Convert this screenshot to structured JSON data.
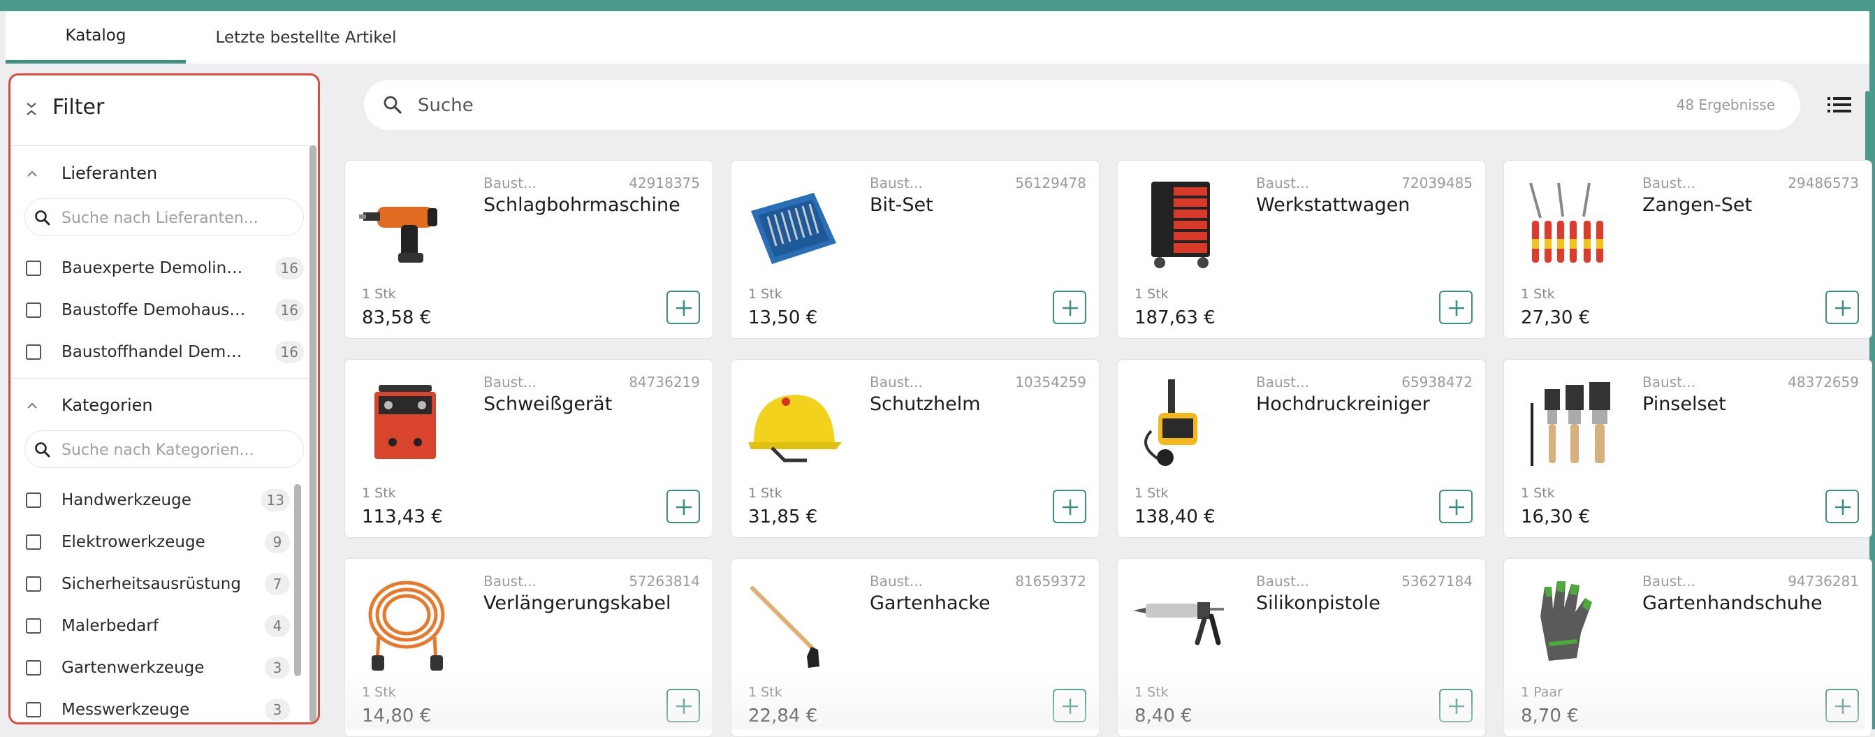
{
  "tabs": [
    {
      "label": "Katalog",
      "active": true
    },
    {
      "label": "Letzte bestellte Artikel",
      "active": false
    }
  ],
  "sidebar": {
    "title": "Filter",
    "sections": [
      {
        "title": "Lieferanten",
        "search_placeholder": "Suche nach Lieferanten...",
        "items": [
          {
            "label": "Bauexperte Demolinger",
            "count": "16"
          },
          {
            "label": "Baustoffe Demohausen",
            "count": "16"
          },
          {
            "label": "Baustoffhandel Demolinger",
            "count": "16"
          }
        ]
      },
      {
        "title": "Kategorien",
        "search_placeholder": "Suche nach Kategorien...",
        "items": [
          {
            "label": "Handwerkzeuge",
            "count": "13"
          },
          {
            "label": "Elektrowerkzeuge",
            "count": "9"
          },
          {
            "label": "Sicherheitsausrüstung",
            "count": "7"
          },
          {
            "label": "Malerbedarf",
            "count": "4"
          },
          {
            "label": "Gartenwerkzeuge",
            "count": "3"
          },
          {
            "label": "Messwerkzeuge",
            "count": "3"
          }
        ]
      }
    ]
  },
  "search": {
    "placeholder": "Suche",
    "results": "48 Ergebnisse"
  },
  "products": [
    {
      "supplier": "Baust...",
      "artno": "42918375",
      "name": "Schlagbohrmaschine",
      "unit": "1 Stk",
      "price": "83,58 €",
      "icon": "drill-icon"
    },
    {
      "supplier": "Baust...",
      "artno": "56129478",
      "name": "Bit-Set",
      "unit": "1 Stk",
      "price": "13,50 €",
      "icon": "bit-set-icon"
    },
    {
      "supplier": "Baust...",
      "artno": "72039485",
      "name": "Werkstattwagen",
      "unit": "1 Stk",
      "price": "187,63 €",
      "icon": "tool-cart-icon"
    },
    {
      "supplier": "Baust...",
      "artno": "29486573",
      "name": "Zangen-Set",
      "unit": "1 Stk",
      "price": "27,30 €",
      "icon": "pliers-icon"
    },
    {
      "supplier": "Baust...",
      "artno": "84736219",
      "name": "Schweißgerät",
      "unit": "1 Stk",
      "price": "113,43 €",
      "icon": "welder-icon"
    },
    {
      "supplier": "Baust...",
      "artno": "10354259",
      "name": "Schutzhelm",
      "unit": "1 Stk",
      "price": "31,85 €",
      "icon": "helmet-icon"
    },
    {
      "supplier": "Baust...",
      "artno": "65938472",
      "name": "Hochdruckreiniger",
      "unit": "1 Stk",
      "price": "138,40 €",
      "icon": "pressure-washer-icon"
    },
    {
      "supplier": "Baust...",
      "artno": "48372659",
      "name": "Pinselset",
      "unit": "1 Stk",
      "price": "16,30 €",
      "icon": "brushes-icon"
    },
    {
      "supplier": "Baust...",
      "artno": "57263814",
      "name": "Verlängerungskabel",
      "unit": "1 Stk",
      "price": "14,80 €",
      "icon": "cable-reel-icon"
    },
    {
      "supplier": "Baust...",
      "artno": "81659372",
      "name": "Gartenhacke",
      "unit": "1 Stk",
      "price": "22,84 €",
      "icon": "hoe-icon"
    },
    {
      "supplier": "Baust...",
      "artno": "53627184",
      "name": "Silikonpistole",
      "unit": "1 Stk",
      "price": "8,40 €",
      "icon": "caulk-gun-icon"
    },
    {
      "supplier": "Baust...",
      "artno": "94736281",
      "name": "Gartenhandschuhe",
      "unit": "1 Paar",
      "price": "8,70 €",
      "icon": "gloves-icon"
    }
  ],
  "colors": {
    "accent": "#3d8f80",
    "topbar": "#4a9a8c",
    "sidebar_border": "#e04a3c"
  }
}
